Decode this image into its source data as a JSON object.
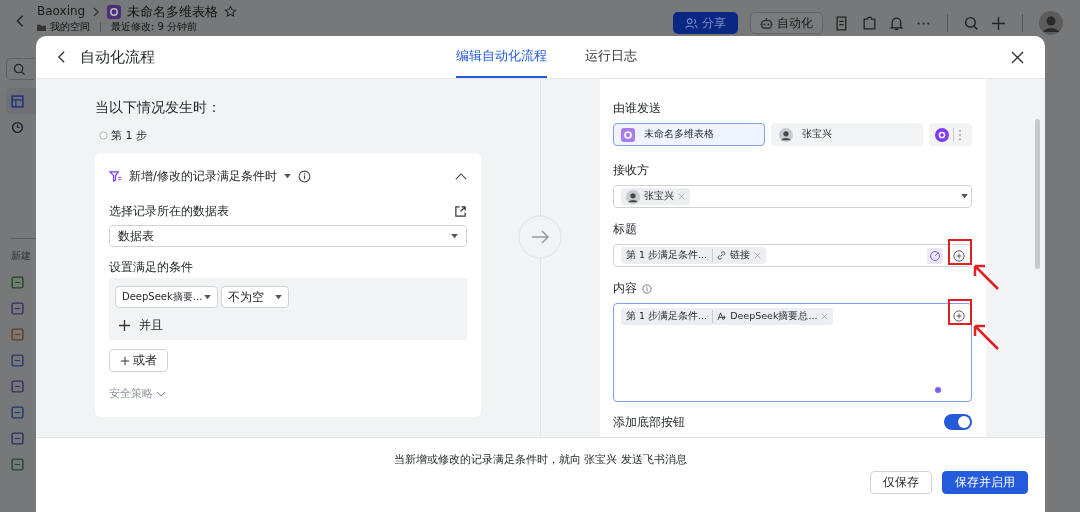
{
  "app_bar": {
    "breadcrumb_root": "Baoxing",
    "doc_title": "未命名多维表格",
    "location": "我的空间",
    "last_modified": "最近修改: 9 分钟前",
    "share_label": "分享",
    "automation_label": "自动化"
  },
  "sidebar": {
    "items": [
      {
        "selected": true
      },
      {
        "selected": false
      }
    ],
    "section_label": "新建"
  },
  "dialog": {
    "title": "自动化流程",
    "tabs": [
      {
        "label": "编辑自动化流程",
        "selected": true
      },
      {
        "label": "运行日志",
        "selected": false
      }
    ]
  },
  "trigger": {
    "heading": "当以下情况发生时：",
    "step_label": "第 1 步",
    "title": "新增/修改的记录满足条件时",
    "table_label": "选择记录所在的数据表",
    "table_value": "数据表",
    "condition_label": "设置满足的条件",
    "conditions": [
      {
        "field": "DeepSeek摘要...",
        "operator": "不为空"
      }
    ],
    "and_label": "并且",
    "or_label": "或者",
    "security_label": "安全策略"
  },
  "action": {
    "sender_label": "由谁发送",
    "senders": [
      {
        "name": "未命名多维表格",
        "kind": "app",
        "selected": true
      },
      {
        "name": "张宝兴",
        "kind": "person",
        "selected": false
      }
    ],
    "recipient_label": "接收方",
    "recipients": [
      "张宝兴"
    ],
    "title_label": "标题",
    "title_tokens": [
      {
        "source": "第 1 步满足条件...",
        "field": "链接",
        "kind": "link"
      }
    ],
    "content_label": "内容",
    "content_tokens": [
      {
        "source": "第 1 步满足条件...",
        "field": "DeepSeek摘要总...",
        "kind": "ai"
      }
    ],
    "bottom_button_label": "添加底部按钮",
    "bottom_button_on": true
  },
  "footer": {
    "summary": "当新增或修改的记录满足条件时，就向 张宝兴 发送飞书消息",
    "buttons": [
      {
        "label": "仅保存",
        "kind": "secondary"
      },
      {
        "label": "保存并启用",
        "kind": "primary"
      }
    ]
  }
}
